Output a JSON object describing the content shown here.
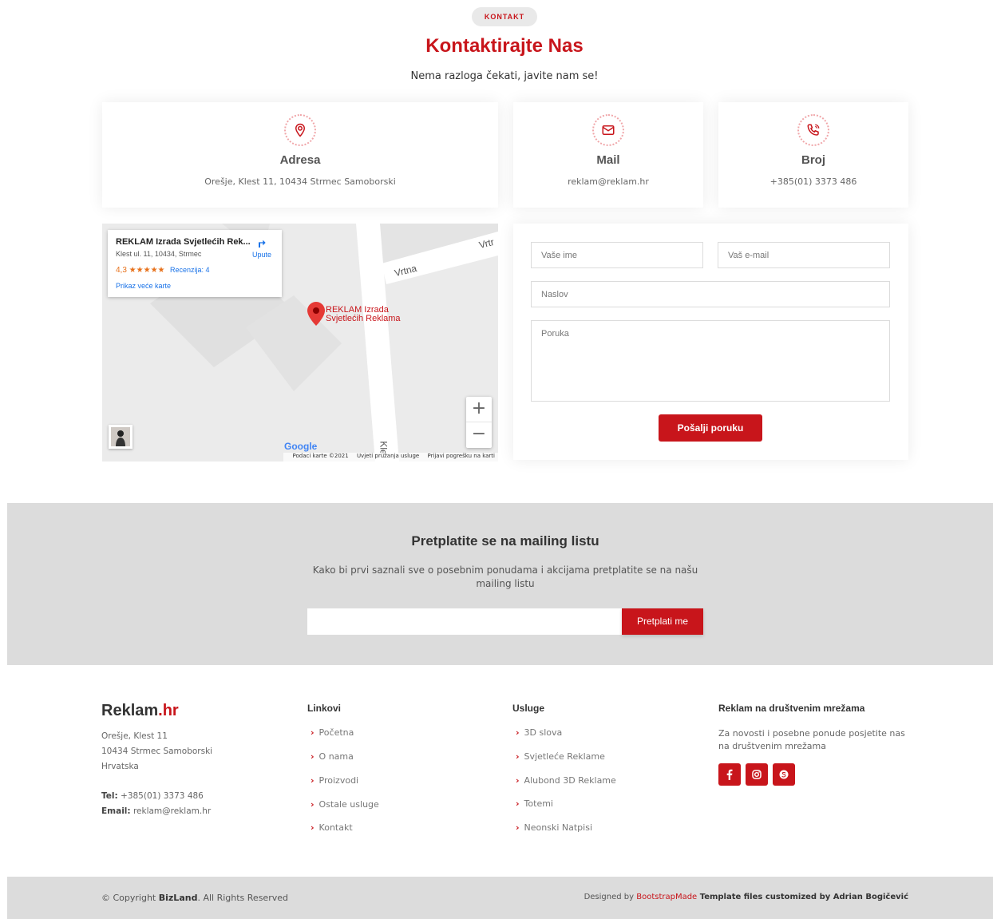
{
  "section": {
    "badge": "KONTAKT",
    "title": "Kontaktirajte Nas",
    "subtitle": "Nema razloga čekati, javite nam se!"
  },
  "info_cards": [
    {
      "icon": "map-pin-icon",
      "title": "Adresa",
      "text": "Orešje, Klest 11, 10434 Strmec Samoborski"
    },
    {
      "icon": "envelope-icon",
      "title": "Mail",
      "text": "reklam@reklam.hr"
    },
    {
      "icon": "phone-icon",
      "title": "Broj",
      "text": "+385(01) 3373 486"
    }
  ],
  "map": {
    "place_name": "REKLAM Izrada Svjetlećih Rek...",
    "address": "Klest ul. 11, 10434, Strmec",
    "rating": "4,3 ★★★★★",
    "reviews": "Recenzija: 4",
    "larger_map": "Prikaz veće karte",
    "directions": "Upute",
    "pin_label_1": "REKLAM Izrada",
    "pin_label_2": "Svjetlećih Reklama",
    "road_1": "Vrtna",
    "road_2": "Vrtr",
    "road_3": "Kle",
    "zoom_in": "+",
    "zoom_out": "−",
    "google": "Google",
    "footer_data": "Podaci karte ©2021",
    "footer_terms": "Uvjeti pružanja usluge",
    "footer_report": "Prijavi pogrešku na karti"
  },
  "form": {
    "name_placeholder": "Vaše ime",
    "email_placeholder": "Vaš e-mail",
    "subject_placeholder": "Naslov",
    "message_placeholder": "Poruka",
    "submit": "Pošalji poruku"
  },
  "newsletter": {
    "title": "Pretplatite se na mailing listu",
    "text": "Kako bi prvi saznali sve o posebnim ponudama i akcijama pretplatite se na našu mailing listu",
    "input_value": "",
    "button": "Pretplati me"
  },
  "footer": {
    "brand_main": "Reklam",
    "brand_accent": ".hr",
    "address_1": "Orešje, Klest 11",
    "address_2": "10434 Strmec Samoborski",
    "address_3": "Hrvatska",
    "tel_label": "Tel:",
    "tel_value": " +385(01) 3373 486",
    "email_label": "Email:",
    "email_value": " reklam@reklam.hr",
    "links_title": "Linkovi",
    "links": [
      "Početna",
      "O nama",
      "Proizvodi",
      "Ostale usluge",
      "Kontakt"
    ],
    "services_title": "Usluge",
    "services": [
      "3D slova",
      "Svjetleće Reklame",
      "Alubond 3D Reklame",
      "Totemi",
      "Neonski Natpisi"
    ],
    "social_title": "Reklam na društvenim mrežama",
    "social_text": "Za novosti i posebne ponude posjetite nas na društvenim mrežama",
    "social_icons": [
      "facebook-icon",
      "instagram-icon",
      "skype-icon"
    ]
  },
  "bottom": {
    "copyright_pre": "© Copyright ",
    "copyright_brand": "BizLand",
    "copyright_post": ". All Rights Reserved",
    "designed_by": "Designed by ",
    "designer": "BootstrapMade",
    "customized": " Template files customized by Adrian Bogičević"
  },
  "colors": {
    "accent": "#c8151b",
    "gray_band": "#dcdcdc"
  }
}
